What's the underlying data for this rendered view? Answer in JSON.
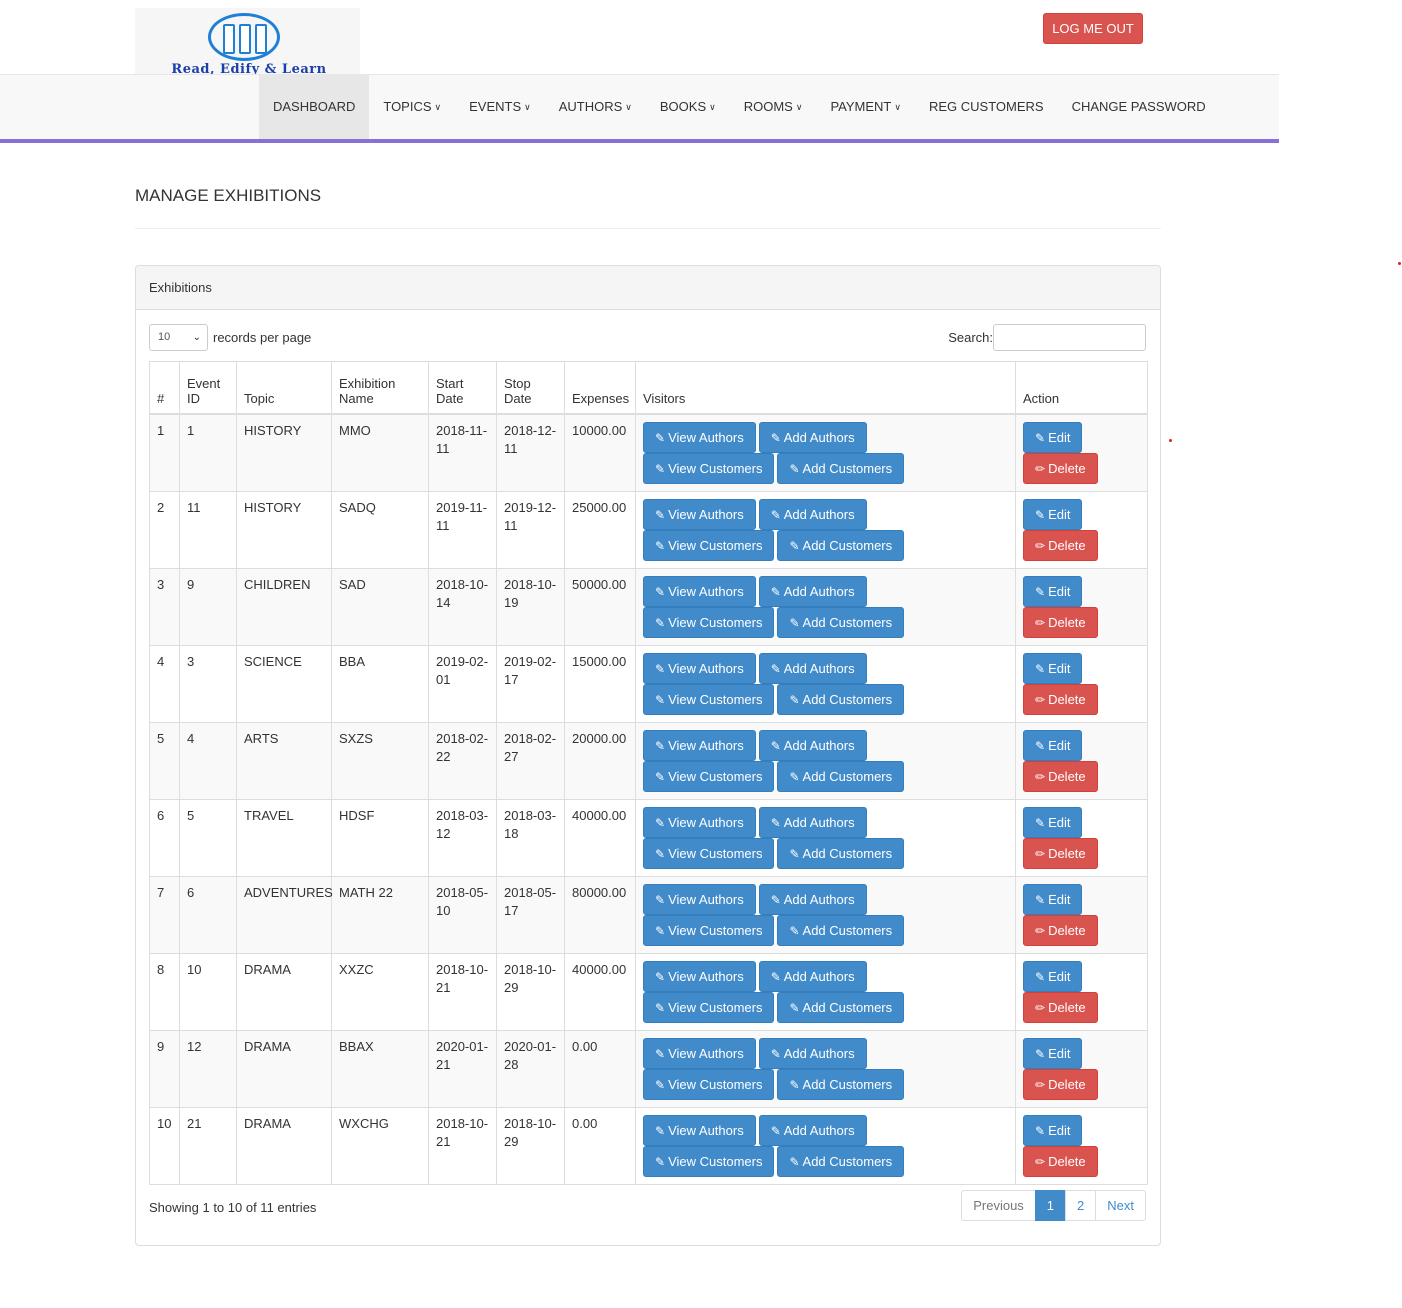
{
  "brand": {
    "logo_text": "Read, Edify & Learn",
    "logout_label": "LOG ME OUT"
  },
  "nav": {
    "items": [
      {
        "label": "DASHBOARD",
        "dropdown": false
      },
      {
        "label": "TOPICS",
        "dropdown": true
      },
      {
        "label": "EVENTS",
        "dropdown": true
      },
      {
        "label": "AUTHORS",
        "dropdown": true
      },
      {
        "label": "BOOKS",
        "dropdown": true
      },
      {
        "label": "ROOMS",
        "dropdown": true
      },
      {
        "label": "PAYMENT",
        "dropdown": true
      },
      {
        "label": "REG CUSTOMERS",
        "dropdown": false
      },
      {
        "label": "CHANGE PASSWORD",
        "dropdown": false
      }
    ]
  },
  "page": {
    "title": "MANAGE EXHIBITIONS"
  },
  "panel": {
    "heading": "Exhibitions"
  },
  "controls": {
    "length_value": "10",
    "length_suffix": "records per page",
    "search_label": "Search:",
    "search_value": ""
  },
  "table": {
    "headers": [
      "#",
      "Event ID",
      "Topic",
      "Exhibition Name",
      "Start Date",
      "Stop Date",
      "Expenses",
      "Visitors",
      "Action"
    ],
    "rows": [
      {
        "num": "1",
        "event_id": "1",
        "topic": "HISTORY",
        "name": "MMO",
        "start": "2018-11-11",
        "stop": "2018-12-11",
        "expenses": "10000.00"
      },
      {
        "num": "2",
        "event_id": "11",
        "topic": "HISTORY",
        "name": "SADQ",
        "start": "2019-11-11",
        "stop": "2019-12-11",
        "expenses": "25000.00"
      },
      {
        "num": "3",
        "event_id": "9",
        "topic": "CHILDREN",
        "name": "SAD",
        "start": "2018-10-14",
        "stop": "2018-10-19",
        "expenses": "50000.00"
      },
      {
        "num": "4",
        "event_id": "3",
        "topic": "SCIENCE",
        "name": "BBA",
        "start": "2019-02-01",
        "stop": "2019-02-17",
        "expenses": "15000.00"
      },
      {
        "num": "5",
        "event_id": "4",
        "topic": "ARTS",
        "name": "SXZS",
        "start": "2018-02-22",
        "stop": "2018-02-27",
        "expenses": "20000.00"
      },
      {
        "num": "6",
        "event_id": "5",
        "topic": "TRAVEL",
        "name": "HDSF",
        "start": "2018-03-12",
        "stop": "2018-03-18",
        "expenses": "40000.00"
      },
      {
        "num": "7",
        "event_id": "6",
        "topic": "ADVENTURES",
        "name": "MATH 22",
        "start": "2018-05-10",
        "stop": "2018-05-17",
        "expenses": "80000.00"
      },
      {
        "num": "8",
        "event_id": "10",
        "topic": "DRAMA",
        "name": "XXZC",
        "start": "2018-10-21",
        "stop": "2018-10-29",
        "expenses": "40000.00"
      },
      {
        "num": "9",
        "event_id": "12",
        "topic": "DRAMA",
        "name": "BBAX",
        "start": "2020-01-21",
        "stop": "2020-01-28",
        "expenses": "0.00"
      },
      {
        "num": "10",
        "event_id": "21",
        "topic": "DRAMA",
        "name": "WXCHG",
        "start": "2018-10-21",
        "stop": "2018-10-29",
        "expenses": "0.00"
      }
    ],
    "buttons": {
      "view_authors": "View Authors",
      "add_authors": "Add Authors",
      "view_customers": "View Customers",
      "add_customers": "Add Customers",
      "edit": "Edit",
      "delete": "Delete"
    }
  },
  "footer": {
    "info": "Showing 1 to 10 of 11 entries",
    "pagination": {
      "previous": "Previous",
      "pages": [
        "1",
        "2"
      ],
      "current": "1",
      "next": "Next"
    }
  },
  "colors": {
    "primary": "#428bca",
    "danger": "#d9534f",
    "nav_accent": "#8a6fd4"
  }
}
